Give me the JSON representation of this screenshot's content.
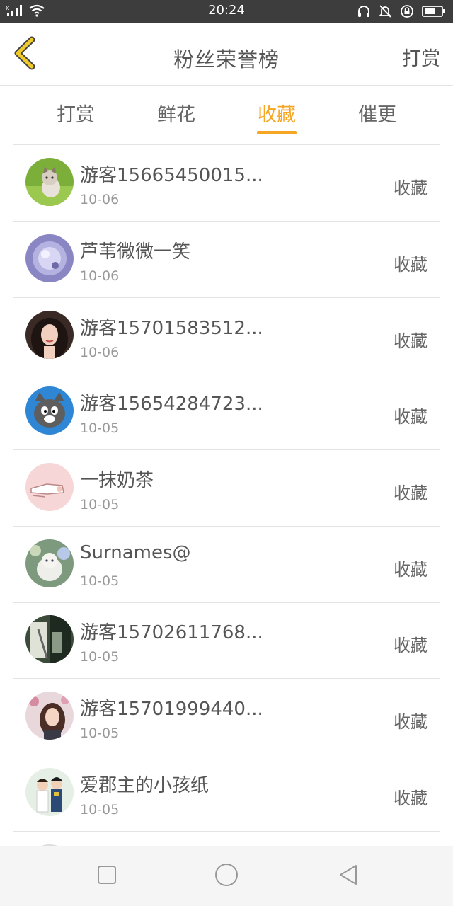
{
  "status_bar": {
    "time": "20:24"
  },
  "header": {
    "title": "粉丝荣誉榜",
    "action_label": "打赏"
  },
  "tabs": [
    {
      "label": "打赏",
      "active": false
    },
    {
      "label": "鲜花",
      "active": false
    },
    {
      "label": "收藏",
      "active": true
    },
    {
      "label": "催更",
      "active": false
    }
  ],
  "list": {
    "items": [
      {
        "name": "游客15665450015...",
        "date": "10-06",
        "action": "收藏",
        "avatar": "kitten-avatar"
      },
      {
        "name": "芦苇微微一笑",
        "date": "10-06",
        "action": "收藏",
        "avatar": "bubble-avatar"
      },
      {
        "name": "游客15701583512...",
        "date": "10-06",
        "action": "收藏",
        "avatar": "woman-portrait-avatar"
      },
      {
        "name": "游客15654284723...",
        "date": "10-05",
        "action": "收藏",
        "avatar": "cartoon-cat-avatar"
      },
      {
        "name": "一抹奶茶",
        "date": "10-05",
        "action": "收藏",
        "avatar": "hand-drawing-avatar"
      },
      {
        "name": "Surnames@",
        "date": "10-05",
        "action": "收藏",
        "avatar": "fluffy-cat-avatar"
      },
      {
        "name": "游客15702611768...",
        "date": "10-05",
        "action": "收藏",
        "avatar": "street-photo-avatar"
      },
      {
        "name": "游客15701999440...",
        "date": "10-05",
        "action": "收藏",
        "avatar": "girl-blossom-avatar"
      },
      {
        "name": "爱郡主的小孩纸",
        "date": "10-05",
        "action": "收藏",
        "avatar": "couple-avatar"
      }
    ]
  },
  "colors": {
    "accent": "#f5a623",
    "back_arrow": "#f0c92a",
    "status_bar": "#3d3d3d"
  }
}
